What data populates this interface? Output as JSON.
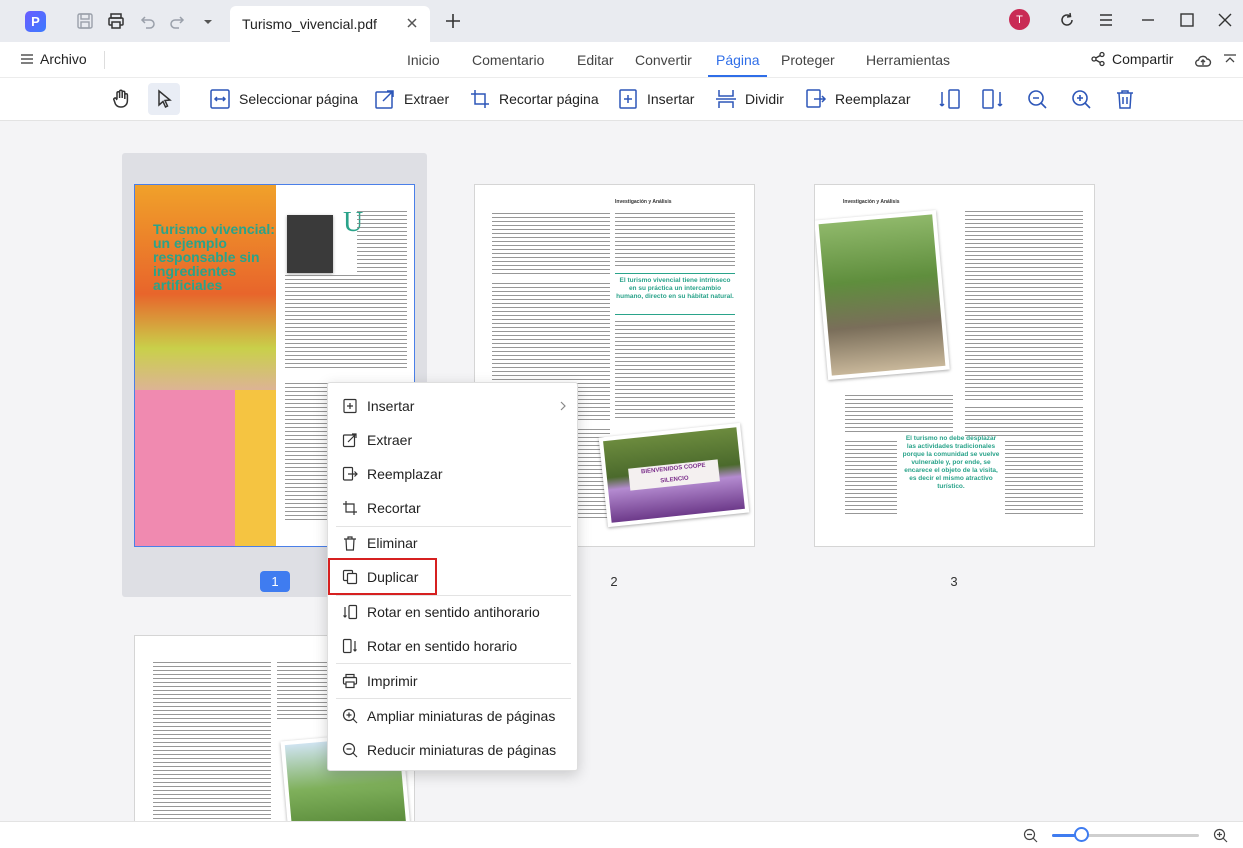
{
  "titlebar": {
    "tab_title": "Turismo_vivencial.pdf",
    "avatar_letter": "T"
  },
  "menubar": {
    "archivo": "Archivo",
    "tabs": [
      "Inicio",
      "Comentario",
      "Editar",
      "Convertir",
      "Página",
      "Proteger",
      "Herramientas"
    ],
    "active_tab": "Página",
    "share": "Compartir"
  },
  "toolbar": {
    "select_page": "Seleccionar página",
    "extract": "Extraer",
    "crop_page": "Recortar página",
    "insert": "Insertar",
    "split": "Dividir",
    "replace": "Reemplazar"
  },
  "pages": {
    "p1": "1",
    "p2": "2",
    "p3": "3",
    "p1_title": "Turismo vivencial: un ejemplo responsable sin ingredientes artificiales",
    "p2_quote": "El turismo vivencial tiene intrínseco en su práctica un intercambio humano, directo en su hábitat natural.",
    "p3_quote": "El turismo no debe desplazar las actividades tradicionales porque la comunidad se vuelve vulnerable y, por ende, se encarece el objeto de la visita, es decir el mismo atractivo turístico.",
    "section_label": "Investigación y Análisis",
    "photo_sign": "BIENVENIDOS COOPE SILENCIO"
  },
  "context_menu": {
    "items": [
      "Insertar",
      "Extraer",
      "Reemplazar",
      "Recortar",
      "Eliminar",
      "Duplicar",
      "Rotar en sentido antihorario",
      "Rotar en sentido horario",
      "Imprimir",
      "Ampliar miniaturas de páginas",
      "Reducir miniaturas de páginas"
    ],
    "highlighted": "Duplicar"
  },
  "statusbar": {
    "zoom_level": 0.2
  },
  "colors": {
    "accent": "#3f7cf0",
    "highlight_border": "#d62020",
    "green_heading": "#2aa38a"
  }
}
